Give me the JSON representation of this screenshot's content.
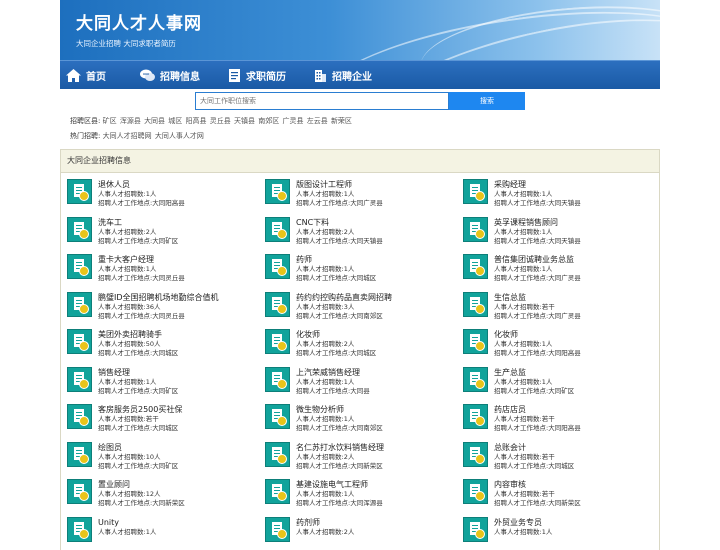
{
  "site": {
    "title": "大同人才人事网",
    "subtitle": "大同企业招聘 大同求职者简历"
  },
  "nav": [
    {
      "label": "首页",
      "icon": "home-icon"
    },
    {
      "label": "招聘信息",
      "icon": "chat-icon"
    },
    {
      "label": "求职简历",
      "icon": "resume-icon"
    },
    {
      "label": "招聘企业",
      "icon": "building-icon"
    }
  ],
  "search": {
    "placeholder": "大同工作职位搜索",
    "button": "搜索"
  },
  "areas": {
    "label": "招聘区县:",
    "items": [
      "矿区",
      "浑源县",
      "大同县",
      "城区",
      "阳高县",
      "灵丘县",
      "天镇县",
      "南郊区",
      "广灵县",
      "左云县",
      "新荣区"
    ]
  },
  "hot": {
    "label": "热门招聘:",
    "items": [
      "大同人才招聘网",
      "大同人事人才网"
    ]
  },
  "panel": {
    "heading": "大同企业招聘信息",
    "count_prefix": "人事人才招聘数:",
    "place_prefix": "招聘人才工作地点:"
  },
  "jobs": [
    {
      "title": "退休人员",
      "count": "1人",
      "place": "大同阳高县"
    },
    {
      "title": "版图设计工程师",
      "count": "1人",
      "place": "大同广灵县"
    },
    {
      "title": "采购经理",
      "count": "1人",
      "place": "大同天镇县"
    },
    {
      "title": "洗车工",
      "count": "2人",
      "place": "大同矿区"
    },
    {
      "title": "CNC下料",
      "count": "2人",
      "place": "大同天镇县"
    },
    {
      "title": "英孚课程销售顾问",
      "count": "1人",
      "place": "大同天镇县"
    },
    {
      "title": "重卡大客户经理",
      "count": "1人",
      "place": "大同灵丘县"
    },
    {
      "title": "药师",
      "count": "1人",
      "place": "大同城区"
    },
    {
      "title": "普信集团诚聘业务总监",
      "count": "1人",
      "place": "大同广灵县"
    },
    {
      "title": "鹏璧ID全国招聘机场地勤综合值机",
      "count": "36人",
      "place": "大同灵丘县"
    },
    {
      "title": "药约约控购药品直卖网招聘",
      "count": "3人",
      "place": "大同南郊区"
    },
    {
      "title": "生信总监",
      "count": "若干",
      "place": "大同广灵县"
    },
    {
      "title": "美团外卖招聘骑手",
      "count": "50人",
      "place": "大同城区"
    },
    {
      "title": "化妆师",
      "count": "2人",
      "place": "大同城区"
    },
    {
      "title": "化妆师",
      "count": "1人",
      "place": "大同阳高县"
    },
    {
      "title": "销售经理",
      "count": "1人",
      "place": "大同矿区"
    },
    {
      "title": "上汽荣威销售经理",
      "count": "1人",
      "place": "大同县"
    },
    {
      "title": "生产总监",
      "count": "1人",
      "place": "大同矿区"
    },
    {
      "title": "客房服务员2500买社保",
      "count": "若干",
      "place": "大同城区"
    },
    {
      "title": "微生物分析师",
      "count": "1人",
      "place": "大同南郊区"
    },
    {
      "title": "药店店员",
      "count": "若干",
      "place": "大同阳高县"
    },
    {
      "title": "绘图员",
      "count": "10人",
      "place": "大同矿区"
    },
    {
      "title": "名仁苏打水饮料销售经理",
      "count": "2人",
      "place": "大同新荣区"
    },
    {
      "title": "总账会计",
      "count": "若干",
      "place": "大同城区"
    },
    {
      "title": "置业顾问",
      "count": "12人",
      "place": "大同新荣区"
    },
    {
      "title": "基建设施电气工程师",
      "count": "1人",
      "place": "大同浑源县"
    },
    {
      "title": "内容审核",
      "count": "若干",
      "place": "大同新荣区"
    },
    {
      "title": "Unity",
      "count": "1人",
      "place": ""
    },
    {
      "title": "药剂师",
      "count": "2人",
      "place": ""
    },
    {
      "title": "外贸业务专员",
      "count": "1人",
      "place": ""
    }
  ],
  "colors": {
    "nav_bg": "#1a5aa5",
    "logo_bg": "#11a39b",
    "panel_head_bg": "#f4f3e3",
    "search_btn": "#1e87f0"
  }
}
